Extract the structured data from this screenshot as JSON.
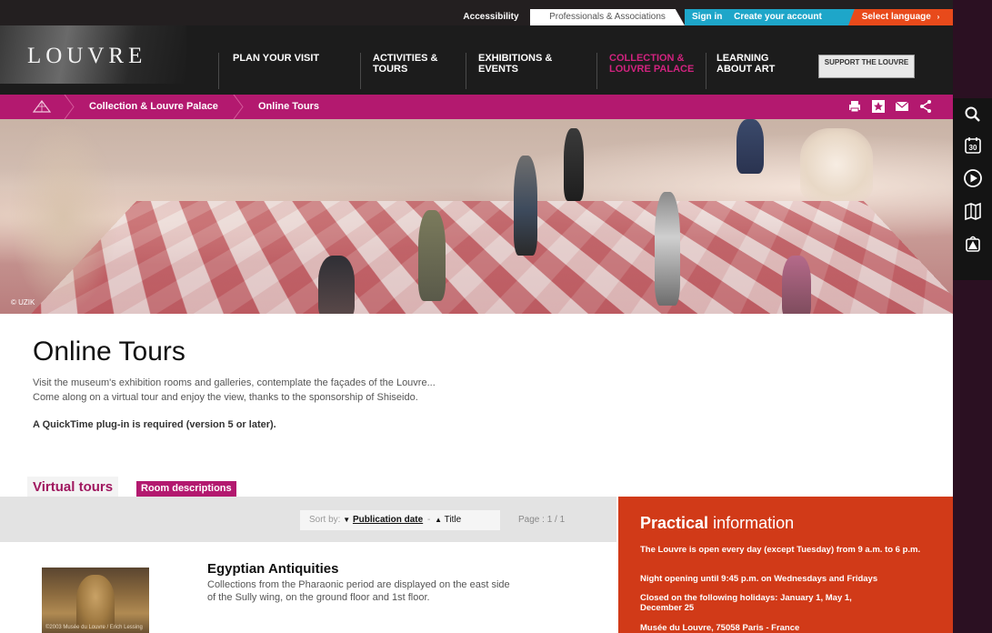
{
  "util_bar": {
    "accessibility": "Accessibility",
    "professionals": "Professionals & Associations",
    "sign_in": "Sign in",
    "create_account": "Create your account",
    "select_language": "Select language"
  },
  "logo": {
    "text": "LOUVRE"
  },
  "nav": {
    "items": [
      {
        "label": "PLAN YOUR VISIT"
      },
      {
        "label": "ACTIVITIES & TOURS"
      },
      {
        "label": "EXHIBITIONS & EVENTS"
      },
      {
        "label": "COLLECTION & LOUVRE PALACE"
      },
      {
        "label": "LEARNING ABOUT ART"
      }
    ],
    "support": "SUPPORT THE LOUVRE"
  },
  "breadcrumb": {
    "items": [
      {
        "label": "Collection & Louvre Palace"
      },
      {
        "label": "Online Tours"
      }
    ]
  },
  "hero": {
    "credit": "© UZIK"
  },
  "intro": {
    "title": "Online Tours",
    "line1": "Visit the museum's exhibition rooms and galleries, contemplate the façades of the Louvre...",
    "line2": "Come along on a virtual tour and enjoy the view, thanks to the sponsorship of Shiseido.",
    "requirement": "A QuickTime plug-in is required (version 5 or later)."
  },
  "tabs": {
    "virtual": "Virtual tours",
    "rooms": "Room descriptions"
  },
  "sort": {
    "label": "Sort by:",
    "pub_date": "Publication date",
    "sep": "-",
    "title": "Title",
    "page_label": "Page :",
    "page_value": "1 / 1"
  },
  "practical": {
    "title_bold": "Practical",
    "title_rest": "information",
    "hours": "The Louvre is open every day (except Tuesday) from 9 a.m. to 6 p.m.",
    "night": "Night opening until 9:45 p.m. on Wednesdays and Fridays",
    "closed": "Closed on the following holidays: January 1, May 1, December 25",
    "address": "Musée du Louvre, 75058 Paris - France"
  },
  "listing": {
    "title": "Egyptian Antiquities",
    "desc1": "Collections from the Pharaonic period are displayed on the east side",
    "desc2": "of the Sully wing, on the ground floor and 1st floor.",
    "thumb_credit": "©2003 Musée du Louvre / Erich Lessing"
  },
  "side_tools": {
    "icons": [
      "search-icon",
      "calendar-30-icon",
      "play-icon",
      "map-icon",
      "pyramid-shop-icon"
    ]
  },
  "colors": {
    "magenta": "#b3196f",
    "accent_blue": "#1ea6c9",
    "lang_orange": "#e84a1b",
    "practical_red": "#d13a18",
    "nav_dark": "#1c1c1c"
  }
}
